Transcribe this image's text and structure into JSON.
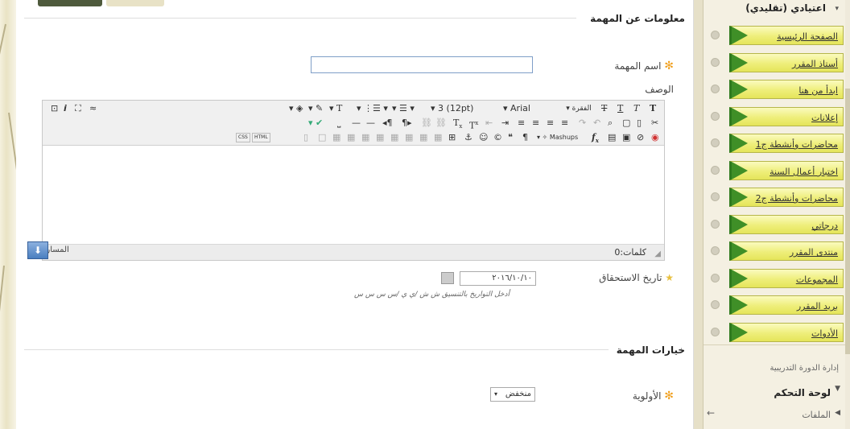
{
  "task_info": {
    "section_title": "معلومات عن المهمة",
    "name_label": "اسم المهمة",
    "name_value": "",
    "description_label": "الوصف"
  },
  "editor": {
    "paragraph_label": "الفقرة",
    "font_value": "Arial",
    "size_value": "3 (12pt)",
    "mashups_label": "Mashups",
    "css_label": "CSS",
    "html_label": "HTML",
    "word_count_label": "كلمات:0",
    "path_label": "المسار:"
  },
  "due_date": {
    "label": "تاريخ الاستحقاق",
    "value": "٢٠١٦/١٠/١٠",
    "hint": "أدخل التواريخ بالتنسيق ش ش /ي ي /س س س س"
  },
  "task_options": {
    "section_title": "خيارات المهمة",
    "priority_label": "الأولوية",
    "priority_value": "منخفض"
  },
  "sidebar": {
    "course_title": "اعتيادي (تقليدي)",
    "items": [
      {
        "label": "الصفحة الرئيسية"
      },
      {
        "label": "أستاذ المقرر"
      },
      {
        "label": "ابدأ من هنا"
      },
      {
        "label": "إعلانات"
      },
      {
        "label": "محاضرات وأنشطة ج1"
      },
      {
        "label": "اختبار أعمال السنة"
      },
      {
        "label": "محاضرات وأنشطة ج2"
      },
      {
        "label": "درجاتي"
      },
      {
        "label": "منتدى المقرر"
      },
      {
        "label": "المجموعات"
      },
      {
        "label": "بريد المقرر"
      },
      {
        "label": "الأدوات"
      }
    ],
    "course_management": "إدارة الدورة التدريبية",
    "control_panel": "لوحة التحكم",
    "files": "الملفات"
  },
  "colors": {
    "nav_button": "#eeee7a",
    "nav_arrow": "#3f8f27",
    "required_star": "#f0a020",
    "input_border": "#7f9fc8"
  }
}
